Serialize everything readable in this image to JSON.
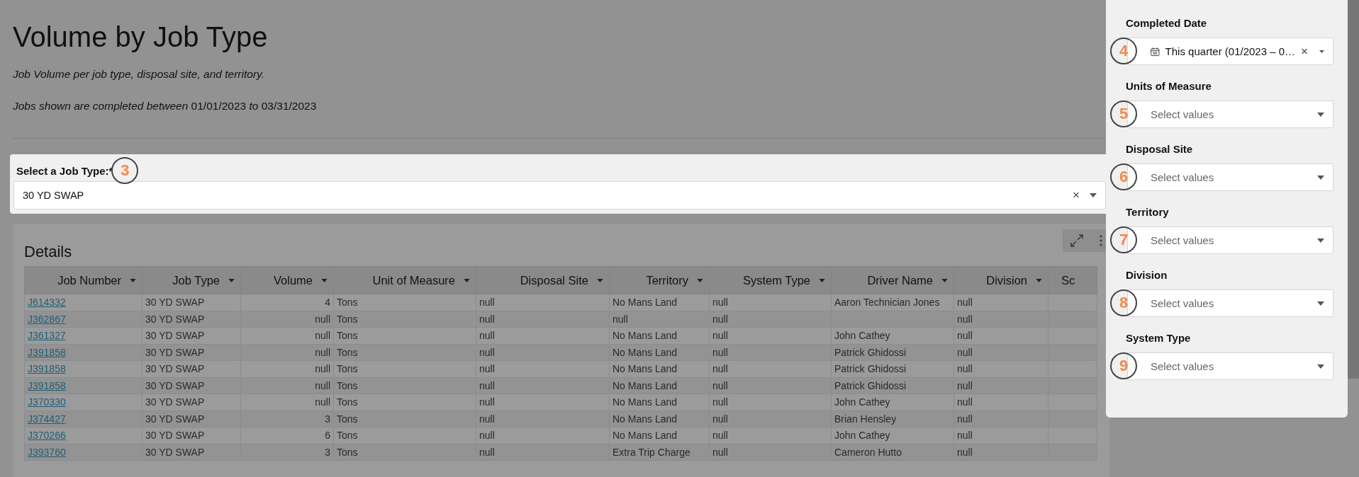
{
  "page": {
    "title": "Volume by Job Type",
    "description": "Job Volume per job type, disposal site, and territory.",
    "date_note": {
      "prefix": "Jobs shown are completed between",
      "start": "01/01/2023",
      "joiner": "to",
      "end": "03/31/2023"
    }
  },
  "job_type_filter": {
    "label": "Select a Job Type:*",
    "value": "30 YD SWAP",
    "clear": "×",
    "marker": "3"
  },
  "details": {
    "title": "Details",
    "columns": [
      {
        "label": "Job Number",
        "sortable": true
      },
      {
        "label": "Job Type",
        "sortable": true
      },
      {
        "label": "Volume",
        "sortable": true
      },
      {
        "label": "Unit of Measure",
        "sortable": true
      },
      {
        "label": "Disposal Site",
        "sortable": true
      },
      {
        "label": "Territory",
        "sortable": true
      },
      {
        "label": "System Type",
        "sortable": true
      },
      {
        "label": "Driver Name",
        "sortable": true
      },
      {
        "label": "Division",
        "sortable": true
      },
      {
        "label": "Sc",
        "sortable": false
      }
    ],
    "rows": [
      [
        "J614332",
        "30 YD SWAP",
        "4",
        "Tons",
        "null",
        "No Mans Land",
        "null",
        "Aaron Technician Jones",
        "null"
      ],
      [
        "J362867",
        "30 YD SWAP",
        "null",
        "Tons",
        "null",
        "null",
        "null",
        null,
        "null"
      ],
      [
        "J361327",
        "30 YD SWAP",
        "null",
        "Tons",
        "null",
        "No Mans Land",
        "null",
        "John Cathey",
        "null"
      ],
      [
        "J391858",
        "30 YD SWAP",
        "null",
        "Tons",
        "null",
        "No Mans Land",
        "null",
        "Patrick Ghidossi",
        "null"
      ],
      [
        "J391858",
        "30 YD SWAP",
        "null",
        "Tons",
        "null",
        "No Mans Land",
        "null",
        "Patrick Ghidossi",
        "null"
      ],
      [
        "J391858",
        "30 YD SWAP",
        "null",
        "Tons",
        "null",
        "No Mans Land",
        "null",
        "Patrick Ghidossi",
        "null"
      ],
      [
        "J370330",
        "30 YD SWAP",
        "null",
        "Tons",
        "null",
        "No Mans Land",
        "null",
        "John Cathey",
        "null"
      ],
      [
        "J374427",
        "30 YD SWAP",
        "3",
        "Tons",
        "null",
        "No Mans Land",
        "null",
        "Brian Hensley",
        "null"
      ],
      [
        "J370266",
        "30 YD SWAP",
        "6",
        "Tons",
        "null",
        "No Mans Land",
        "null",
        "John Cathey",
        "null"
      ],
      [
        "J393760",
        "30 YD SWAP",
        "3",
        "Tons",
        "null",
        "Extra Trip Charge",
        "null",
        "Cameron Hutto",
        "null"
      ]
    ]
  },
  "filter_panel": {
    "filters": [
      {
        "kind": "date",
        "label": "Completed Date",
        "value": "This quarter (01/2023 – 0…",
        "clear": "×",
        "marker": "4"
      },
      {
        "kind": "select",
        "label": "Units of Measure",
        "placeholder": "Select values",
        "marker": "5"
      },
      {
        "kind": "select",
        "label": "Disposal Site",
        "placeholder": "Select values",
        "marker": "6"
      },
      {
        "kind": "select",
        "label": "Territory",
        "placeholder": "Select values",
        "marker": "7"
      },
      {
        "kind": "select",
        "label": "Division",
        "placeholder": "Select values",
        "marker": "8"
      },
      {
        "kind": "select",
        "label": "System Type",
        "placeholder": "Select values",
        "marker": "9"
      }
    ]
  }
}
